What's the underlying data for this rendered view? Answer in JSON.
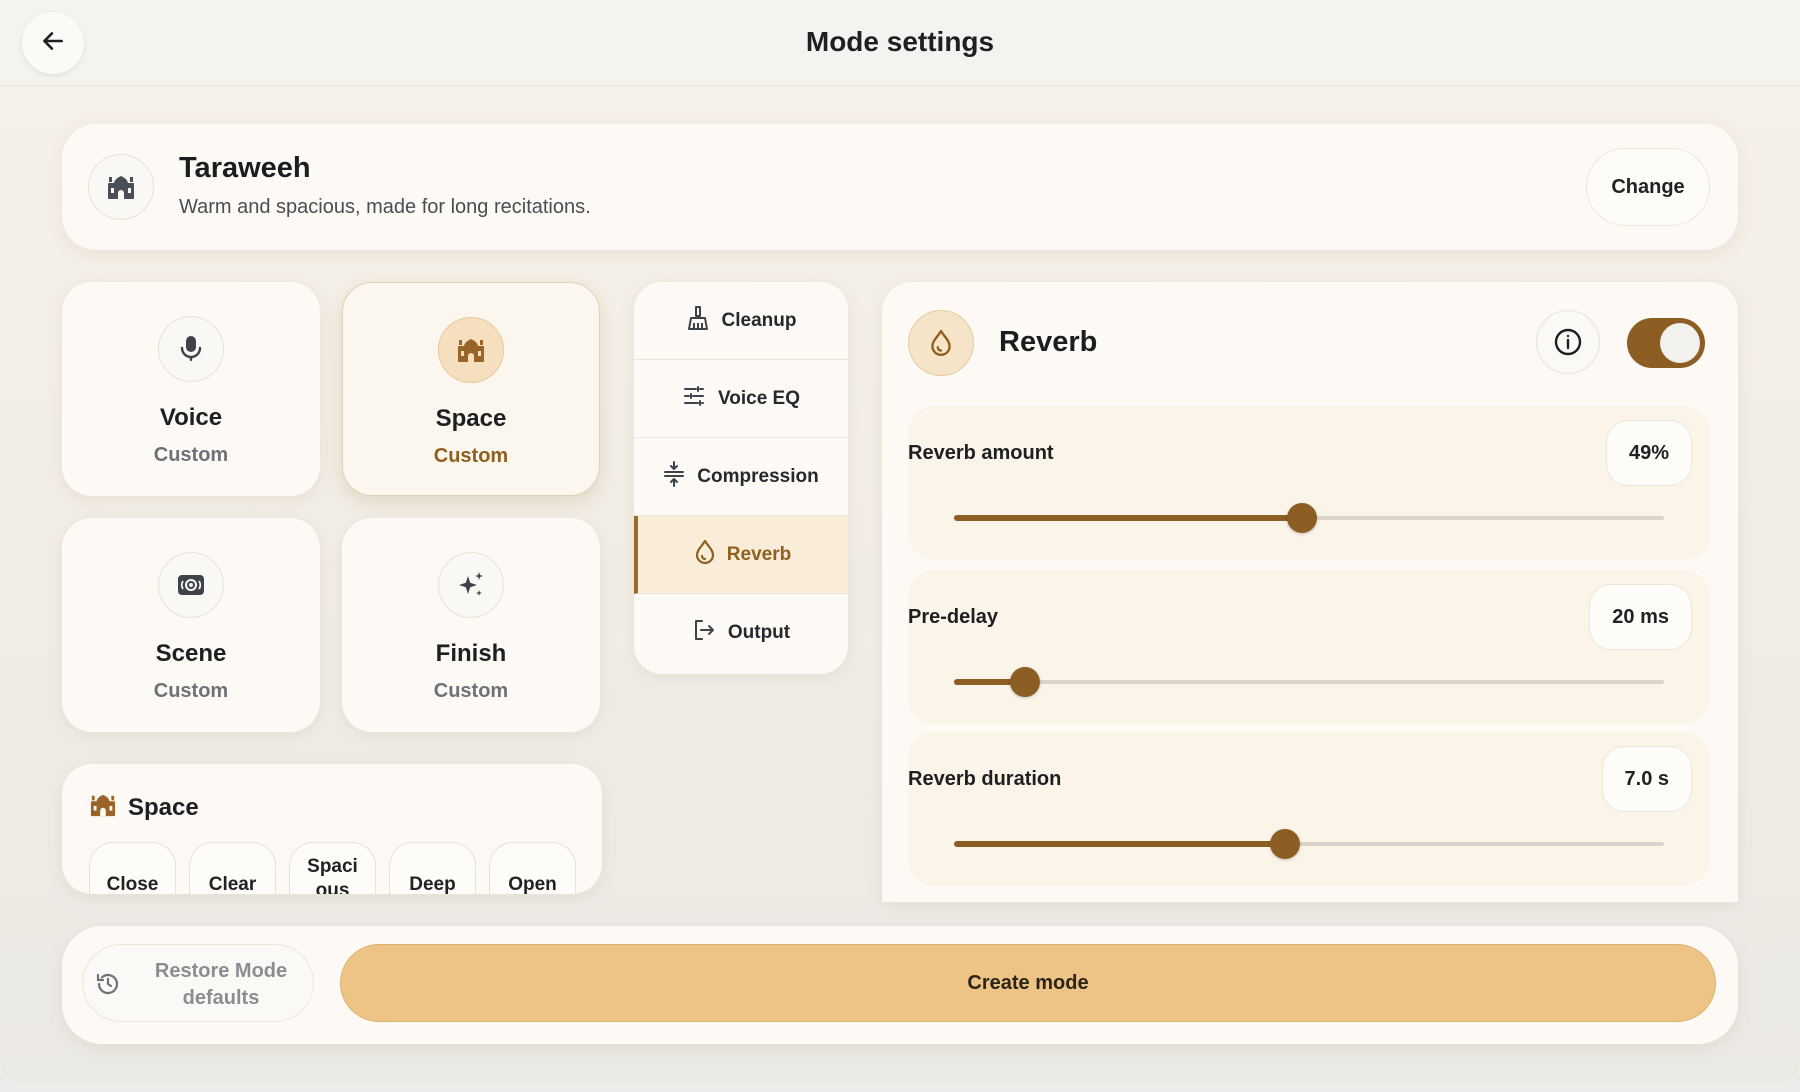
{
  "header": {
    "title": "Mode settings",
    "back_icon": "arrow-left-icon"
  },
  "mode": {
    "name": "Taraweeh",
    "description": "Warm and spacious, made for long recitations.",
    "icon": "mosque-icon",
    "change_label": "Change"
  },
  "categories": [
    {
      "title": "Voice",
      "subtitle": "Custom",
      "icon": "microphone-icon",
      "active": false
    },
    {
      "title": "Space",
      "subtitle": "Custom",
      "icon": "mosque-icon",
      "active": true
    },
    {
      "title": "Scene",
      "subtitle": "Custom",
      "icon": "scene-icon",
      "active": false
    },
    {
      "title": "Finish",
      "subtitle": "Custom",
      "icon": "sparkle-icon",
      "active": false
    }
  ],
  "space_panel": {
    "title": "Space",
    "icon": "mosque-icon",
    "chips": [
      "Close",
      "Clear",
      "Spacious",
      "Deep",
      "Open"
    ]
  },
  "tabs": [
    {
      "label": "Cleanup",
      "icon": "broom-icon",
      "active": false
    },
    {
      "label": "Voice EQ",
      "icon": "sliders-icon",
      "active": false
    },
    {
      "label": "Compression",
      "icon": "compress-icon",
      "active": false
    },
    {
      "label": "Reverb",
      "icon": "drop-icon",
      "active": true
    },
    {
      "label": "Output",
      "icon": "exit-icon",
      "active": false
    }
  ],
  "reverb": {
    "title": "Reverb",
    "icon": "drop-icon",
    "info_icon": "info-icon",
    "enabled": true,
    "params": [
      {
        "label": "Reverb amount",
        "value": "49%",
        "fraction": 0.49
      },
      {
        "label": "Pre-delay",
        "value": "20 ms",
        "fraction": 0.1
      },
      {
        "label": "Reverb duration",
        "value": "7.0 s",
        "fraction": 0.466
      }
    ]
  },
  "footer": {
    "restore_label": "Restore Mode defaults",
    "restore_icon": "history-icon",
    "create_label": "Create mode"
  },
  "colors": {
    "accent": "#8c5e24",
    "accent_light": "#edc486",
    "active_tab_bg": "#f9ecd9"
  }
}
